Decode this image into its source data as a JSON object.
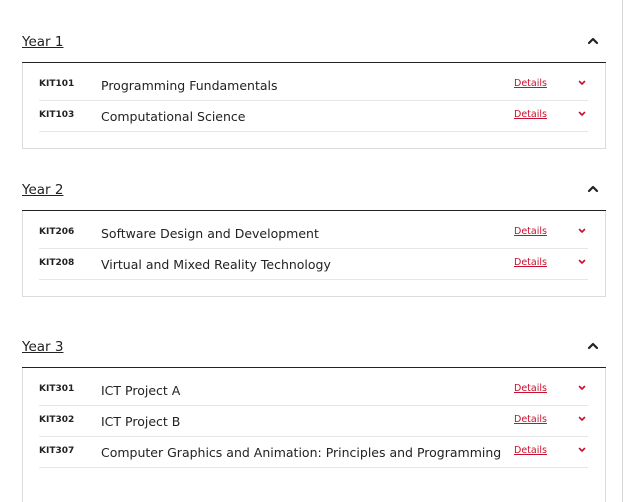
{
  "years": [
    {
      "title": "Year 1",
      "units": [
        {
          "code": "KIT101",
          "name": "Programming Fundamentals",
          "details": "Details"
        },
        {
          "code": "KIT103",
          "name": "Computational Science",
          "details": "Details"
        }
      ]
    },
    {
      "title": "Year 2",
      "units": [
        {
          "code": "KIT206",
          "name": "Software Design and Development",
          "details": "Details"
        },
        {
          "code": "KIT208",
          "name": "Virtual and Mixed Reality Technology",
          "details": "Details"
        }
      ]
    },
    {
      "title": "Year 3",
      "units": [
        {
          "code": "KIT301",
          "name": "ICT Project A",
          "details": "Details"
        },
        {
          "code": "KIT302",
          "name": "ICT Project B",
          "details": "Details"
        },
        {
          "code": "KIT307",
          "name": "Computer Graphics and Animation: Principles and Programming",
          "details": "Details"
        }
      ]
    }
  ],
  "icons": {
    "collapse": "chevron-up-icon",
    "expand": "chevron-down-icon"
  },
  "colors": {
    "link": "#c8102e",
    "text": "#222222",
    "border": "#dcdcdc"
  }
}
